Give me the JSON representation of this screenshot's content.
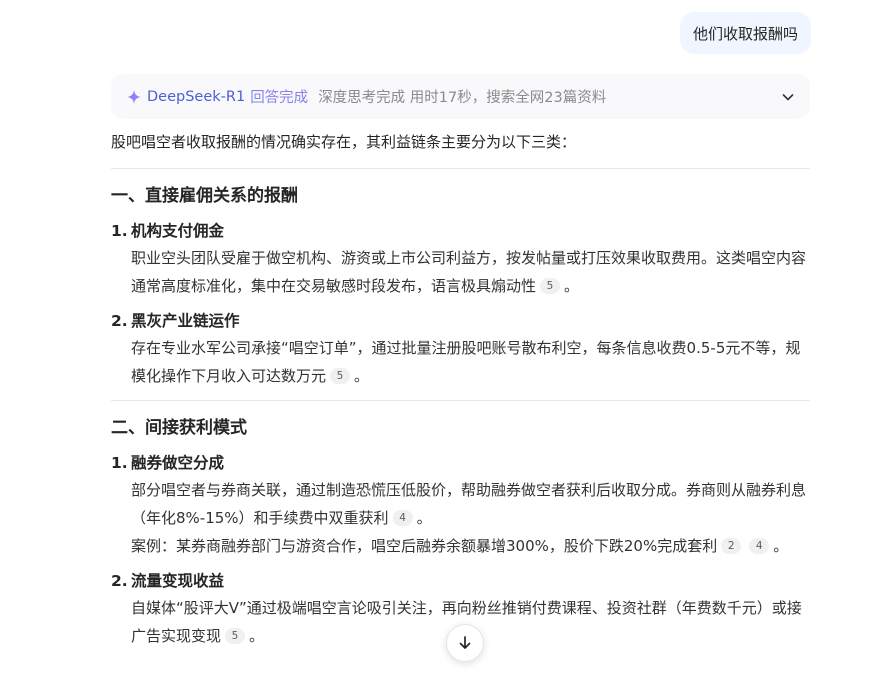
{
  "user_message": "他们收取报酬吗",
  "thinking": {
    "model": "DeepSeek-R1",
    "status": "回答完成",
    "meta": "深度思考完成 用时17秒，搜索全网23篇资料"
  },
  "answer": {
    "intro": "股吧唱空者收取报酬的情况确实存在，其利益链条主要分为以下三类：",
    "sections": [
      {
        "title": "一、直接雇佣关系的报酬",
        "items": [
          {
            "num": "1.",
            "title": "机构支付佣金",
            "paras": [
              {
                "text": "职业空头团队受雇于做空机构、游资或上市公司利益方，按发帖量或打压效果收取费用。这类唱空内容通常高度标准化，集中在交易敏感时段发布，语言极具煽动性",
                "cites": [
                  "5"
                ],
                "tail": "。"
              }
            ]
          },
          {
            "num": "2.",
            "title": "黑灰产业链运作",
            "paras": [
              {
                "text": "存在专业水军公司承接“唱空订单”，通过批量注册股吧账号散布利空，每条信息收费0.5-5元不等，规模化操作下月收入可达数万元",
                "cites": [
                  "5"
                ],
                "tail": "。"
              }
            ]
          }
        ]
      },
      {
        "title": "二、间接获利模式",
        "items": [
          {
            "num": "1.",
            "title": "融券做空分成",
            "paras": [
              {
                "text": "部分唱空者与券商关联，通过制造恐慌压低股价，帮助融券做空者获利后收取分成。券商则从融券利息（年化8%-15%）和手续费中双重获利",
                "cites": [
                  "4"
                ],
                "tail": "。"
              },
              {
                "text": "案例：某券商融券部门与游资合作，唱空后融券余额暴增300%，股价下跌20%完成套利",
                "cites": [
                  "2",
                  "4"
                ],
                "tail": "。"
              }
            ]
          },
          {
            "num": "2.",
            "title": "流量变现收益",
            "paras": [
              {
                "text": "自媒体“股评大V”通过极端唱空言论吸引关注，再向粉丝推销付费课程、投资社群（年费数千元）或接广告实现变现",
                "cites": [
                  "5"
                ],
                "tail": "。"
              }
            ]
          }
        ]
      }
    ]
  },
  "icons": {
    "thinking": "sparkle-icon",
    "expand": "chevron-down-icon",
    "scroll": "arrow-down-icon"
  },
  "colors": {
    "model": "#4b5fd6",
    "status": "#8a83e8",
    "user_bubble": "#eff6ff"
  }
}
